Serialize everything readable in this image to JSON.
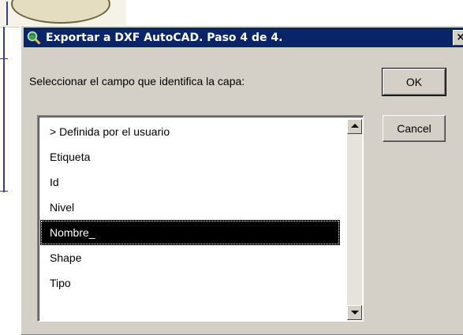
{
  "dialog": {
    "title": "Exportar a DXF AutoCAD. Paso 4 de 4.",
    "close_label": "×",
    "prompt": "Seleccionar el campo que identifica la capa:",
    "ok_label": "OK",
    "cancel_label": "Cancel"
  },
  "list": {
    "items": [
      {
        "label": "> Definida por el usuario"
      },
      {
        "label": "Etiqueta"
      },
      {
        "label": "Id"
      },
      {
        "label": "Nivel"
      },
      {
        "label": "Nombre_"
      },
      {
        "label": "Shape"
      },
      {
        "label": "Tipo"
      }
    ],
    "selected_index": 4
  },
  "icons": {
    "app": "magnifier-globe-icon",
    "close": "close-icon",
    "scroll_up": "arrow-up-icon",
    "scroll_down": "arrow-down-icon"
  },
  "colors": {
    "titlebar": "#0a246a",
    "dialog_bg": "#d4d0c8",
    "selection": "#000000"
  }
}
